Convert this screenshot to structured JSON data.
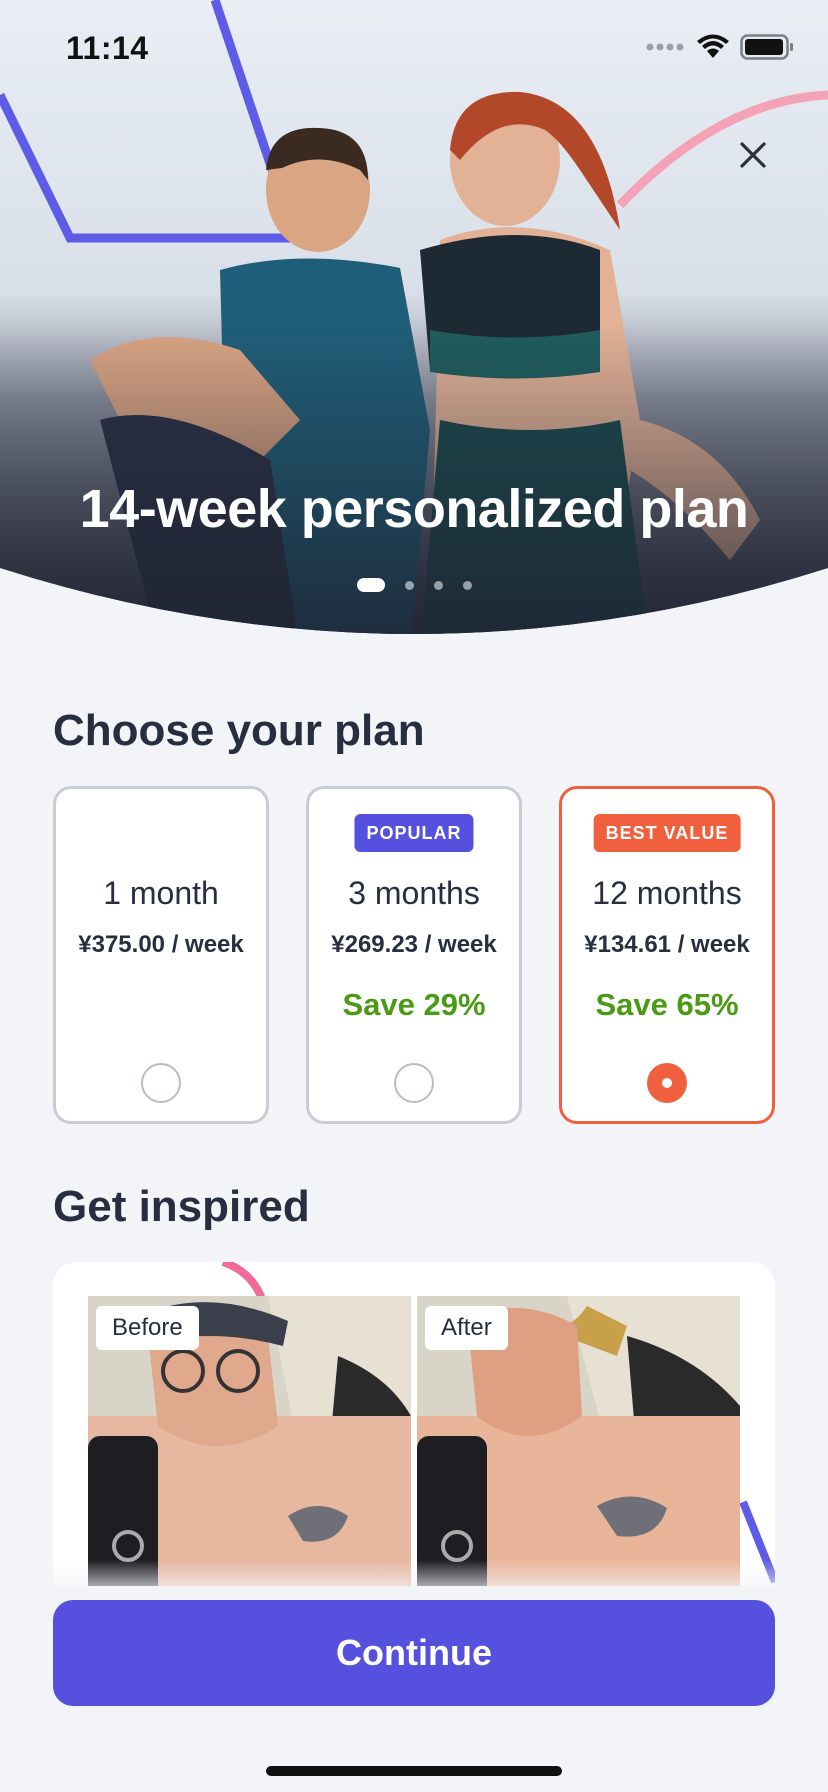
{
  "status_bar": {
    "time": "11:14"
  },
  "hero": {
    "title": "14-week personalized plan",
    "pages": 4,
    "active_page": 1,
    "close_icon": "close-icon"
  },
  "plans_section": {
    "title": "Choose your plan",
    "plans": [
      {
        "badge": "",
        "name": "1 month",
        "price": "¥375.00 / week",
        "save": "",
        "selected": false
      },
      {
        "badge": "POPULAR",
        "name": "3 months",
        "price": "¥269.23 / week",
        "save": "Save 29%",
        "selected": false
      },
      {
        "badge": "BEST VALUE",
        "name": "12 months",
        "price": "¥134.61 / week",
        "save": "Save 65%",
        "selected": true
      }
    ]
  },
  "inspired_section": {
    "title": "Get inspired",
    "before_label": "Before",
    "after_label": "After"
  },
  "cta": {
    "label": "Continue"
  },
  "colors": {
    "accent": "#5650df",
    "selected": "#f0603e",
    "save": "#4b9a13",
    "text": "#272e3f"
  }
}
